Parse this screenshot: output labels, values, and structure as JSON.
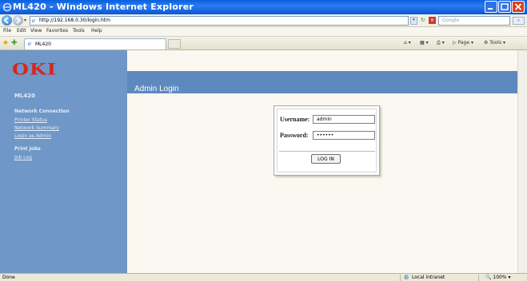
{
  "window": {
    "title": "ML420 - Windows Internet Explorer",
    "icon": "ie-icon"
  },
  "address": {
    "url": "http://192.168.0.30/login.htm",
    "search_placeholder": "Google"
  },
  "menu": {
    "items": [
      "File",
      "Edit",
      "View",
      "Favorites",
      "Tools",
      "Help"
    ]
  },
  "tab": {
    "label": "ML420"
  },
  "commands": {
    "page": "Page",
    "tools": "Tools"
  },
  "sidebar": {
    "logo": "OKI",
    "model": "ML420",
    "network_heading": "Network Connection",
    "links": [
      "Printer Status",
      "Network Summary",
      "Login as Admin"
    ],
    "print_jobs_heading": "Print Jobs",
    "job_link": "Job Log"
  },
  "main": {
    "header_title": "Admin Login"
  },
  "login": {
    "username_label": "Username:",
    "username_value": "admin",
    "password_label": "Password:",
    "password_value": "••••••",
    "button_label": "LOG IN"
  },
  "status": {
    "text": "Done",
    "zone": "Local intranet",
    "zoom": "100%"
  },
  "colors": {
    "sidebar_bg": "#6f97c7",
    "header_bg": "#5d89be",
    "logo_red": "#d9261c",
    "content_bg": "#fbf8f1"
  }
}
